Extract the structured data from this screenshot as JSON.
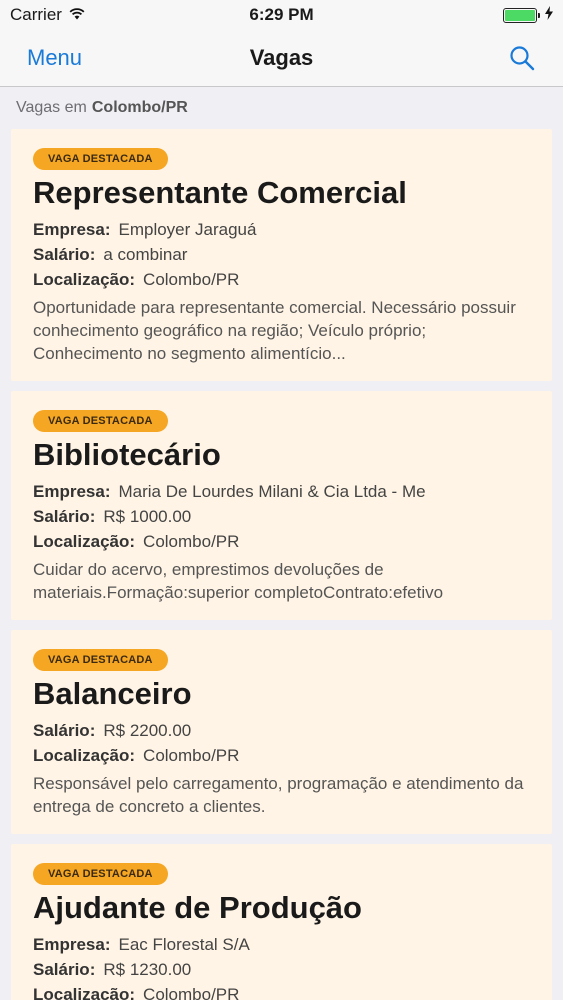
{
  "status": {
    "carrier": "Carrier",
    "time": "6:29 PM"
  },
  "nav": {
    "menu_label": "Menu",
    "title": "Vagas",
    "search_icon": "search-icon"
  },
  "section": {
    "prefix": "Vagas em",
    "location": "Colombo/PR"
  },
  "labels": {
    "empresa": "Empresa:",
    "salario": "Salário:",
    "localizacao": "Localização:"
  },
  "jobs": [
    {
      "badge": "VAGA DESTACADA",
      "title": "Representante Comercial",
      "empresa": "Employer Jaraguá",
      "salario": "a combinar",
      "localizacao": "Colombo/PR",
      "descricao": "Oportunidade para representante comercial. Necessário possuir conhecimento geográfico na região; Veículo próprio; Conhecimento no segmento alimentício..."
    },
    {
      "badge": "VAGA DESTACADA",
      "title": "Bibliotecário",
      "empresa": "Maria De Lourdes Milani & Cia Ltda - Me",
      "salario": "R$ 1000.00",
      "localizacao": "Colombo/PR",
      "descricao": "Cuidar do acervo, emprestimos devoluções de materiais.Formação:superior completoContrato:efetivo"
    },
    {
      "badge": "VAGA DESTACADA",
      "title": "Balanceiro",
      "salario": "R$ 2200.00",
      "localizacao": "Colombo/PR",
      "descricao": "Responsável pelo carregamento, programação e atendimento da entrega de concreto a clientes."
    },
    {
      "badge": "VAGA DESTACADA",
      "title": "Ajudante de Produção",
      "empresa": "Eac Florestal S/A",
      "salario": "R$ 1230.00",
      "localizacao": "Colombo/PR",
      "descricao": ""
    }
  ],
  "colors": {
    "accent": "#1a7ad8",
    "badge": "#f5a623",
    "card_bg": "#fff4e5",
    "battery": "#4cd964"
  }
}
